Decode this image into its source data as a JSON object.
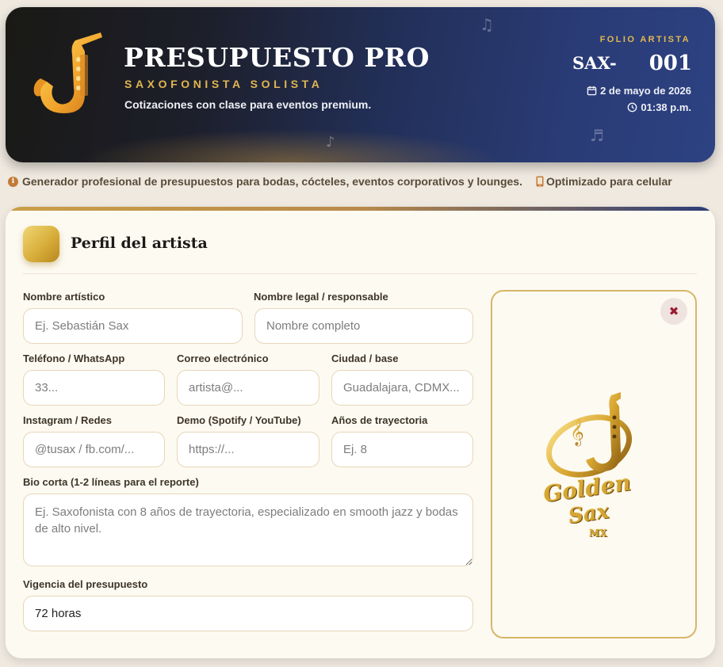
{
  "header": {
    "title": "PRESUPUESTO PRO",
    "subtitle": "SAXOFONISTA SOLISTA",
    "tagline": "Cotizaciones con clase para eventos premium.",
    "folio_label": "FOLIO ARTISTA",
    "folio_prefix": "SAX-",
    "folio_number": "001",
    "date": "2 de mayo de 2026",
    "time": "01:38 p.m."
  },
  "info": {
    "description": "Generador profesional de presupuestos para bodas, cócteles, eventos corporativos y lounges.",
    "mobile": "Optimizado para celular"
  },
  "section": {
    "title": "Perfil del artista"
  },
  "form": {
    "stage_name": {
      "label": "Nombre artístico",
      "placeholder": "Ej. Sebastián Sax",
      "value": ""
    },
    "legal_name": {
      "label": "Nombre legal / responsable",
      "placeholder": "Nombre completo",
      "value": ""
    },
    "phone": {
      "label": "Teléfono / WhatsApp",
      "placeholder": "33...",
      "value": ""
    },
    "email": {
      "label": "Correo electrónico",
      "placeholder": "artista@...",
      "value": ""
    },
    "city": {
      "label": "Ciudad / base",
      "placeholder": "Guadalajara, CDMX...",
      "value": ""
    },
    "instagram": {
      "label": "Instagram / Redes",
      "placeholder": "@tusax / fb.com/...",
      "value": ""
    },
    "demo": {
      "label": "Demo (Spotify / YouTube)",
      "placeholder": "https://...",
      "value": ""
    },
    "years": {
      "label": "Años de trayectoria",
      "placeholder": "Ej. 8",
      "value": ""
    },
    "bio": {
      "label": "Bio corta (1-2 líneas para el reporte)",
      "placeholder": "Ej. Saxofonista con 8 años de trayectoria, especializado en smooth jazz y bodas de alto nivel.",
      "value": ""
    },
    "validity": {
      "label": "Vigencia del presupuesto",
      "placeholder": "",
      "value": "72 horas"
    }
  },
  "logo": {
    "word1": "Golden",
    "word2": "Sax",
    "word3": "MX",
    "close_symbol": "✖"
  },
  "colors": {
    "gold": "#e1b650",
    "navy": "#2a3c77",
    "remove": "#9b1c32"
  }
}
